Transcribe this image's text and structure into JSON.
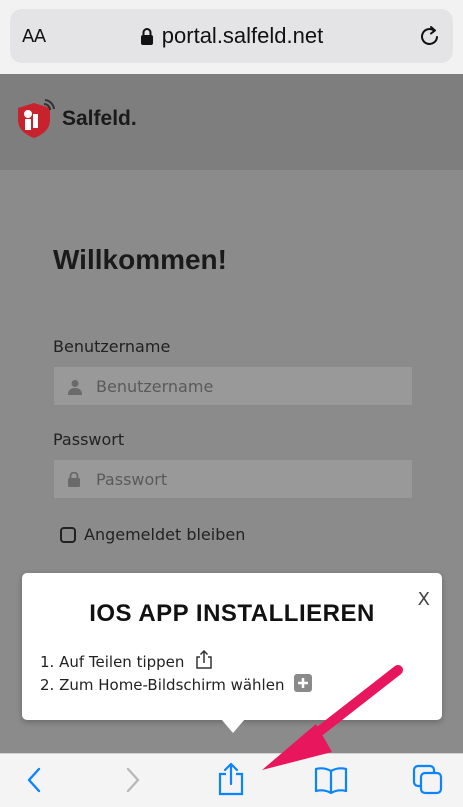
{
  "browser": {
    "text_size_label": "AA",
    "url": "portal.salfeld.net",
    "icons": [
      "lock-icon",
      "reload-icon",
      "back-icon",
      "forward-icon",
      "share-icon",
      "bookmarks-icon",
      "tabs-icon"
    ]
  },
  "header": {
    "logo_text": "Salfeld."
  },
  "login": {
    "title": "Willkommen!",
    "username_label": "Benutzername",
    "username_placeholder": "Benutzername",
    "password_label": "Passwort",
    "password_placeholder": "Passwort",
    "remember_label": "Angemeldet bleiben",
    "remember_checked": false
  },
  "install_popup": {
    "title": "IOS APP INSTALLIEREN",
    "close_label": "X",
    "steps": [
      {
        "text": "1. Auf Teilen tippen",
        "icon": "share-icon"
      },
      {
        "text": "2. Zum Home-Bildschirm wählen",
        "icon": "plus-box-icon"
      }
    ]
  },
  "colors": {
    "accent_arrow": "#e8175d",
    "ios_blue": "#0a84ff",
    "logo_red": "#c8232c"
  }
}
